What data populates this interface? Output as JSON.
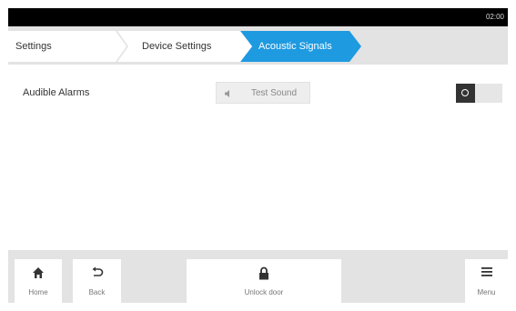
{
  "status_bar": {
    "time": "02:00"
  },
  "breadcrumb": [
    {
      "label": "Settings"
    },
    {
      "label": "Device Settings"
    },
    {
      "label": "Acoustic Signals"
    }
  ],
  "settings": {
    "audible_alarms_label": "Audible Alarms",
    "test_sound_label": "Test Sound",
    "toggle_state": "off"
  },
  "bottom_bar": {
    "home_label": "Home",
    "back_label": "Back",
    "unlock_label": "Unlock door",
    "menu_label": "Menu"
  },
  "colors": {
    "accent": "#1e9ae0",
    "background": "#e3e3e3",
    "statusbar": "#000000"
  },
  "icons": [
    "speaker-icon",
    "home-icon",
    "back-arrow-icon",
    "lock-icon",
    "menu-icon"
  ]
}
